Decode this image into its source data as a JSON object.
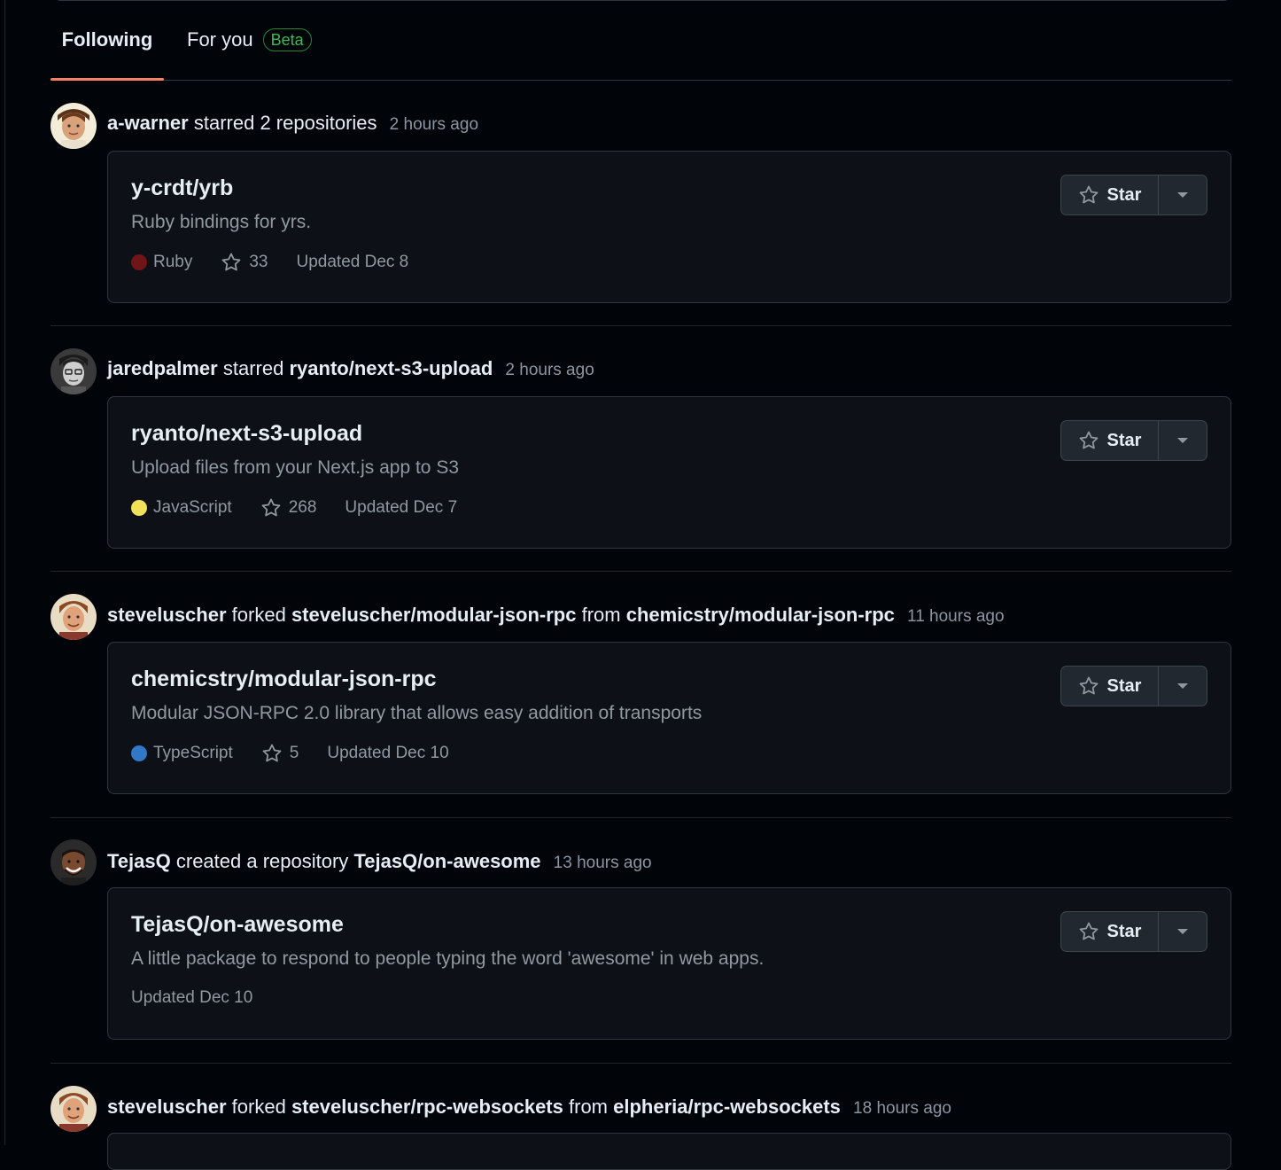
{
  "tabs": {
    "following": "Following",
    "for_you": "For you",
    "beta_badge": "Beta"
  },
  "events": [
    {
      "actor": "a-warner",
      "action": "starred",
      "target": "2 repositories",
      "from_text": "",
      "source": "",
      "time": "2 hours ago",
      "repo": {
        "name": "y-crdt/yrb",
        "description": "Ruby bindings for yrs.",
        "language": "Ruby",
        "language_color": "#701516",
        "stars": "33",
        "updated": "Updated Dec 8"
      }
    },
    {
      "actor": "jaredpalmer",
      "action": "starred",
      "target": "ryanto/next-s3-upload",
      "from_text": "",
      "source": "",
      "time": "2 hours ago",
      "repo": {
        "name": "ryanto/next-s3-upload",
        "description": "Upload files from your Next.js app to S3",
        "language": "JavaScript",
        "language_color": "#f1e05a",
        "stars": "268",
        "updated": "Updated Dec 7"
      }
    },
    {
      "actor": "steveluscher",
      "action": "forked",
      "target": "steveluscher/modular-json-rpc",
      "from_text": "from",
      "source": "chemicstry/modular-json-rpc",
      "time": "11 hours ago",
      "repo": {
        "name": "chemicstry/modular-json-rpc",
        "description": "Modular JSON-RPC 2.0 library that allows easy addition of transports",
        "language": "TypeScript",
        "language_color": "#3178c6",
        "stars": "5",
        "updated": "Updated Dec 10"
      }
    },
    {
      "actor": "TejasQ",
      "action": "created a repository",
      "target": "TejasQ/on-awesome",
      "from_text": "",
      "source": "",
      "time": "13 hours ago",
      "repo": {
        "name": "TejasQ/on-awesome",
        "description": "A little package to respond to people typing the word 'awesome' in web apps.",
        "updated": "Updated Dec 10"
      }
    },
    {
      "actor": "steveluscher",
      "action": "forked",
      "target": "steveluscher/rpc-websockets",
      "from_text": "from",
      "source": "elpheria/rpc-websockets",
      "time": "18 hours ago"
    }
  ],
  "star_button_label": "Star",
  "colors": {
    "background": "#010409",
    "card": "#0d1117",
    "tab_underline": "#f78166",
    "beta": "#3fb950"
  },
  "icons": {
    "star": "star-icon",
    "caret": "triangle-down-icon",
    "unfold": "unfold-icon"
  }
}
